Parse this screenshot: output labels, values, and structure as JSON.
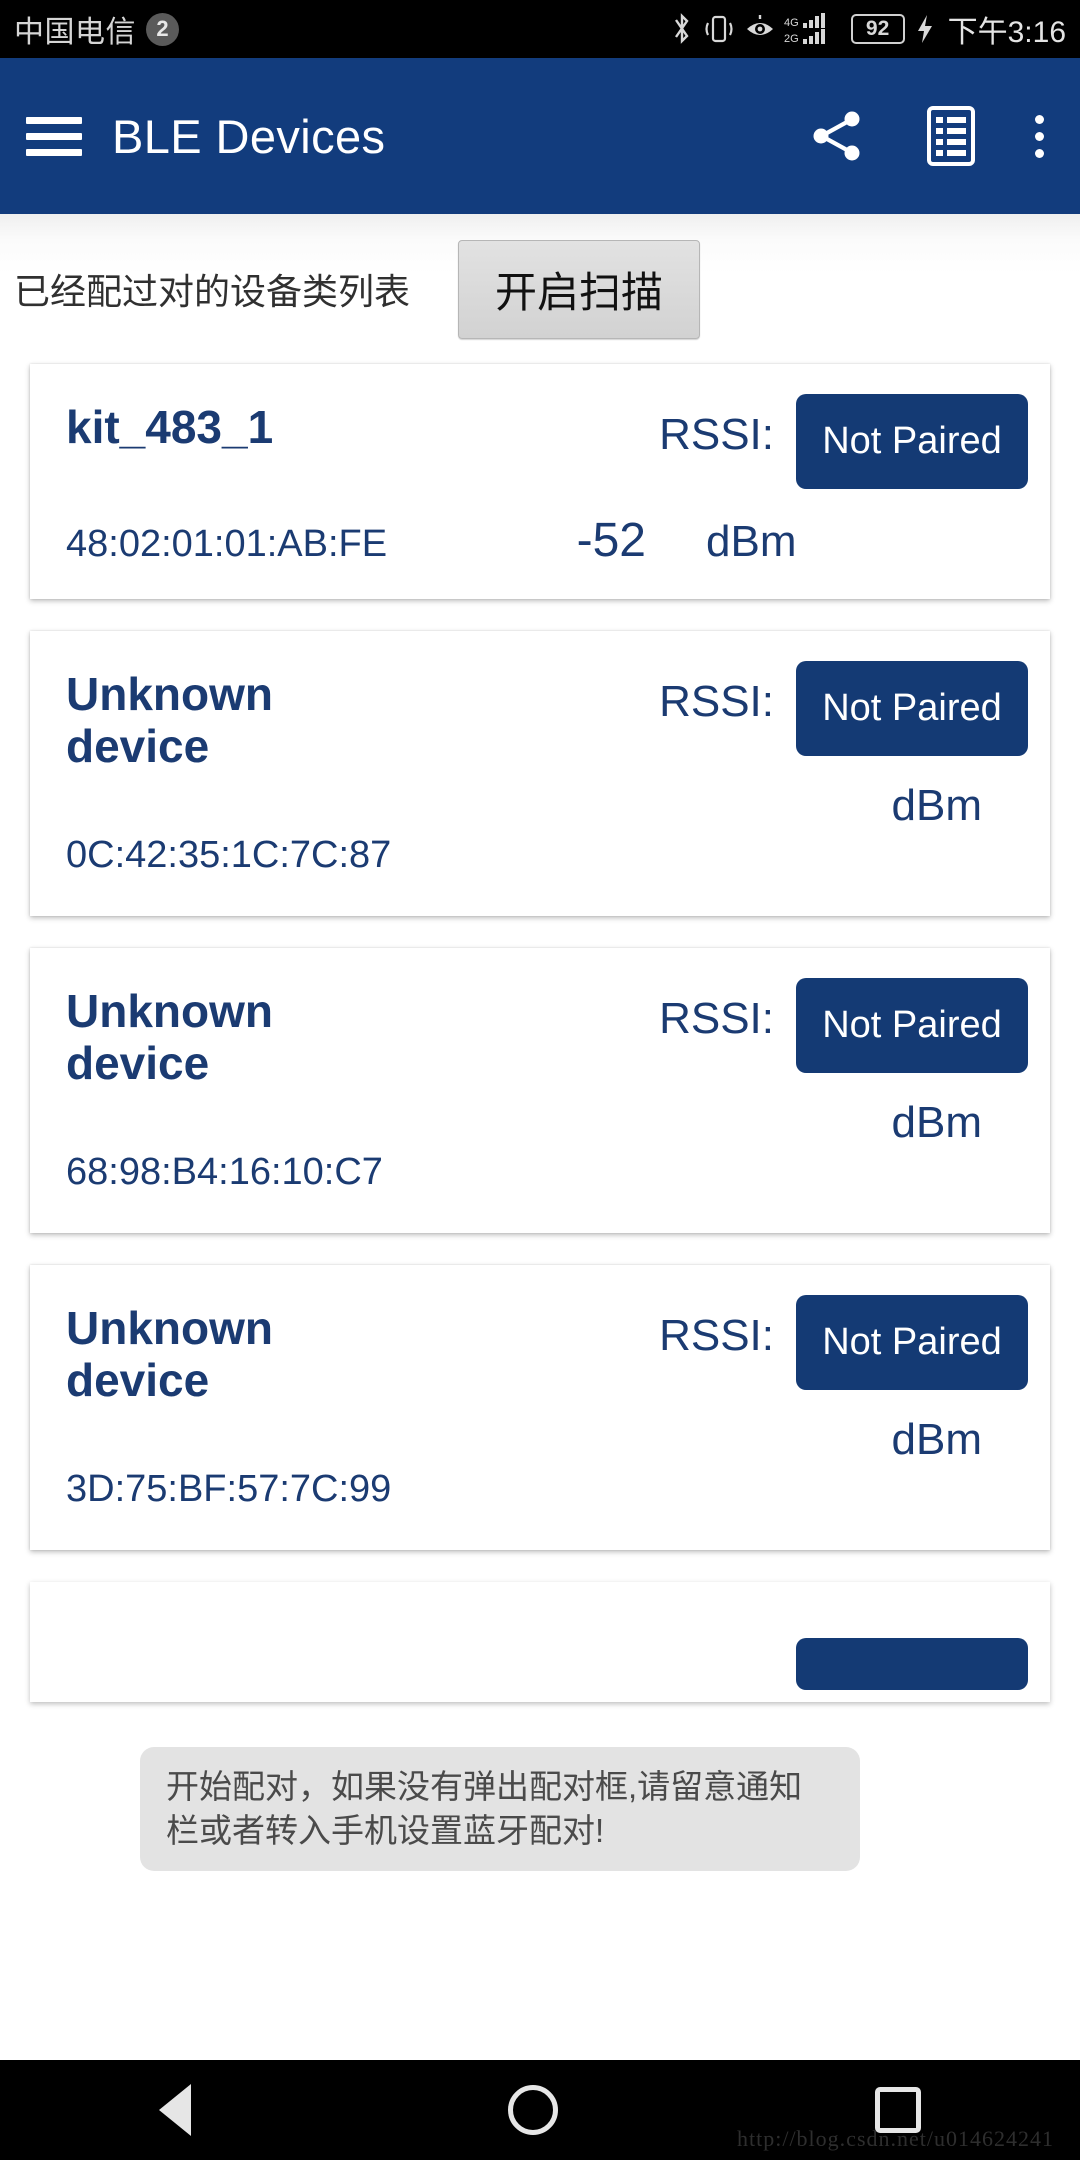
{
  "status_bar": {
    "carrier": "中国电信",
    "sim_badge": "2",
    "battery_level": "92",
    "clock": "下午3:16",
    "icons": [
      "bluetooth-icon",
      "vibrate-icon",
      "eye-icon",
      "signal-4g-2g-icon",
      "battery-icon",
      "charging-bolt-icon"
    ]
  },
  "app_bar": {
    "title": "BLE Devices",
    "menu_icon": "hamburger-menu-icon",
    "share_icon": "share-icon",
    "list_icon": "list-icon",
    "overflow_icon": "overflow-menu-icon",
    "background_color": "#123c7d"
  },
  "header": {
    "paired_label": "已经配过对的设备类列表",
    "scan_button": "开启扫描"
  },
  "labels": {
    "rssi": "RSSI:",
    "dbm": "dBm"
  },
  "devices": [
    {
      "name": "kit_483_1",
      "mac": "48:02:01:01:AB:FE",
      "rssi": "-52",
      "pair_status": "Not Paired",
      "two_line": false
    },
    {
      "name": "Unknown device",
      "mac": "0C:42:35:1C:7C:87",
      "rssi": "",
      "pair_status": "Not Paired",
      "two_line": true
    },
    {
      "name": "Unknown device",
      "mac": "68:98:B4:16:10:C7",
      "rssi": "",
      "pair_status": "Not Paired",
      "two_line": true
    },
    {
      "name": "Unknown device",
      "mac": "3D:75:BF:57:7C:99",
      "rssi": "",
      "pair_status": "Not Paired",
      "two_line": true
    }
  ],
  "partial_device": {
    "pair_status": ""
  },
  "toast": {
    "message": "开始配对，如果没有弹出配对框,请留意通知栏或者转入手机设置蓝牙配对!"
  },
  "nav_bar": {
    "back_icon": "back-triangle-icon",
    "home_icon": "home-circle-icon",
    "recents_icon": "recents-square-icon"
  },
  "watermark": "http://blog.csdn.net/u014624241",
  "colors": {
    "brand_navy": "#123c7d",
    "text_navy": "#1b3b72",
    "button_navy": "#143a74"
  }
}
